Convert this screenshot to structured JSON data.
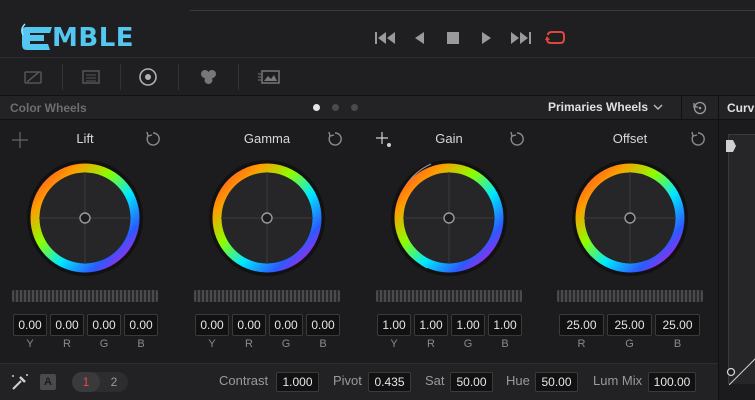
{
  "app": {
    "logo_text": "MBLE"
  },
  "transport": {
    "buttons": [
      "skip-to-start",
      "step-back",
      "stop",
      "play",
      "skip-to-end",
      "loop"
    ],
    "accent": "#e0463c"
  },
  "panel": {
    "title": "Color Wheels",
    "mode_label": "Primaries Wheels",
    "pages_active": 0
  },
  "curves": {
    "title": "Curv"
  },
  "wheels": [
    {
      "name": "Lift",
      "values": [
        "0.00",
        "0.00",
        "0.00",
        "0.00"
      ],
      "channels": [
        "Y",
        "R",
        "G",
        "B"
      ]
    },
    {
      "name": "Gamma",
      "values": [
        "0.00",
        "0.00",
        "0.00",
        "0.00"
      ],
      "channels": [
        "Y",
        "R",
        "G",
        "B"
      ]
    },
    {
      "name": "Gain",
      "values": [
        "1.00",
        "1.00",
        "1.00",
        "1.00"
      ],
      "channels": [
        "Y",
        "R",
        "G",
        "B"
      ]
    },
    {
      "name": "Offset",
      "values": [
        "25.00",
        "25.00",
        "25.00"
      ],
      "channels": [
        "R",
        "G",
        "B"
      ]
    }
  ],
  "bottom": {
    "auto_label": "A",
    "page1": "1",
    "page2": "2",
    "contrast_label": "Contrast",
    "contrast_value": "1.000",
    "pivot_label": "Pivot",
    "pivot_value": "0.435",
    "sat_label": "Sat",
    "sat_value": "50.00",
    "hue_label": "Hue",
    "hue_value": "50.00",
    "lummix_label": "Lum Mix",
    "lummix_value": "100.00"
  },
  "colors": {
    "logo": "#53c7f0",
    "active_page": "#e24b4b",
    "loop": "#e0463c"
  }
}
